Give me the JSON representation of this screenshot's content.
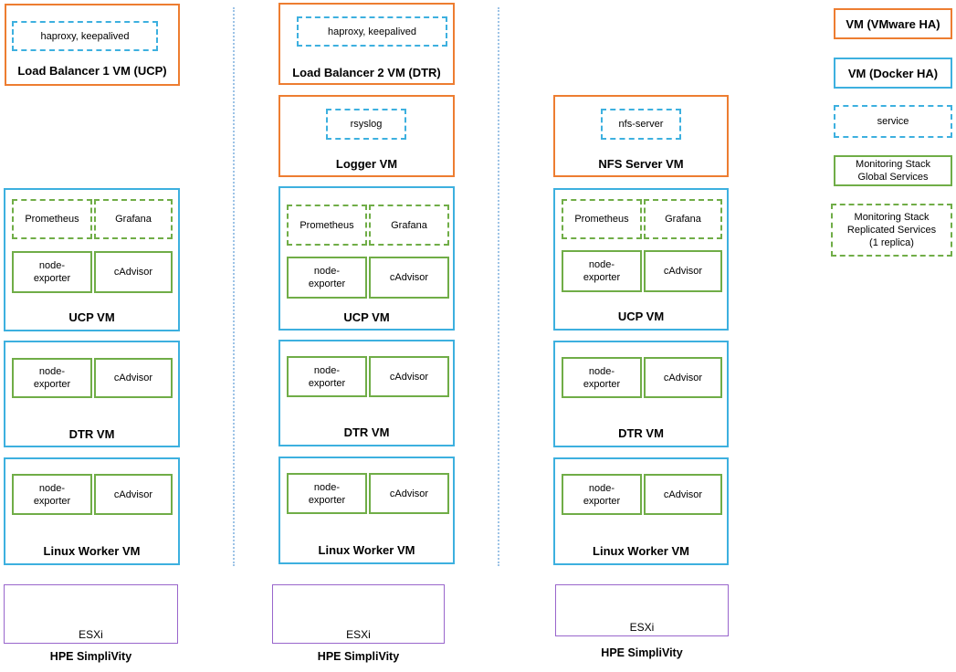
{
  "diagram": {
    "legend": {
      "vmware_ha": "VM (VMware HA)",
      "docker_ha": "VM (Docker HA)",
      "service": "service",
      "global": "Monitoring Stack\nGlobal Services",
      "global_line1": "Monitoring Stack",
      "global_line2": "Global Services",
      "replicated_line1": "Monitoring Stack",
      "replicated_line2": "Replicated Services",
      "replicated_line3": "(1 replica)",
      "colors": {
        "vmware_ha": "#ED7D31",
        "docker_ha": "#3DB0DF",
        "service": "#3DB0DF",
        "monitoring": "#70AD47",
        "esxi": "#9966CC"
      }
    },
    "columns": [
      {
        "top_vm": {
          "title": "Load Balancer 1 VM (UCP)",
          "service": "haproxy, keepalived"
        },
        "ucp": {
          "title": "UCP VM",
          "replicated": [
            "Prometheus",
            "Grafana"
          ],
          "global_a1": "node-",
          "global_a2": "exporter",
          "global_b": "cAdvisor"
        },
        "dtr": {
          "title": "DTR VM",
          "global_a1": "node-",
          "global_a2": "exporter",
          "global_b": "cAdvisor"
        },
        "worker": {
          "title": "Linux Worker VM",
          "global_a1": "node-",
          "global_a2": "exporter",
          "global_b": "cAdvisor"
        },
        "esxi": "ESXi",
        "host": "HPE  SimpliVity"
      },
      {
        "top_vm": {
          "title": "Load Balancer 2 VM (DTR)",
          "service": "haproxy, keepalived"
        },
        "mid_vm": {
          "title": "Logger VM",
          "service": "rsyslog"
        },
        "ucp": {
          "title": "UCP VM",
          "replicated": [
            "Prometheus",
            "Grafana"
          ],
          "global_a1": "node-",
          "global_a2": "exporter",
          "global_b": "cAdvisor"
        },
        "dtr": {
          "title": "DTR VM",
          "global_a1": "node-",
          "global_a2": "exporter",
          "global_b": "cAdvisor"
        },
        "worker": {
          "title": "Linux Worker VM",
          "global_a1": "node-",
          "global_a2": "exporter",
          "global_b": "cAdvisor"
        },
        "esxi": "ESXi",
        "host": "HPE  SimpliVity"
      },
      {
        "mid_vm": {
          "title": "NFS Server VM",
          "service": "nfs-server"
        },
        "ucp": {
          "title": "UCP VM",
          "replicated": [
            "Prometheus",
            "Grafana"
          ],
          "global_a1": "node-",
          "global_a2": "exporter",
          "global_b": "cAdvisor"
        },
        "dtr": {
          "title": "DTR VM",
          "global_a1": "node-",
          "global_a2": "exporter",
          "global_b": "cAdvisor"
        },
        "worker": {
          "title": "Linux Worker VM",
          "global_a1": "node-",
          "global_a2": "exporter",
          "global_b": "cAdvisor"
        },
        "esxi": "ESXi",
        "host": "HPE  SimpliVity"
      }
    ]
  }
}
